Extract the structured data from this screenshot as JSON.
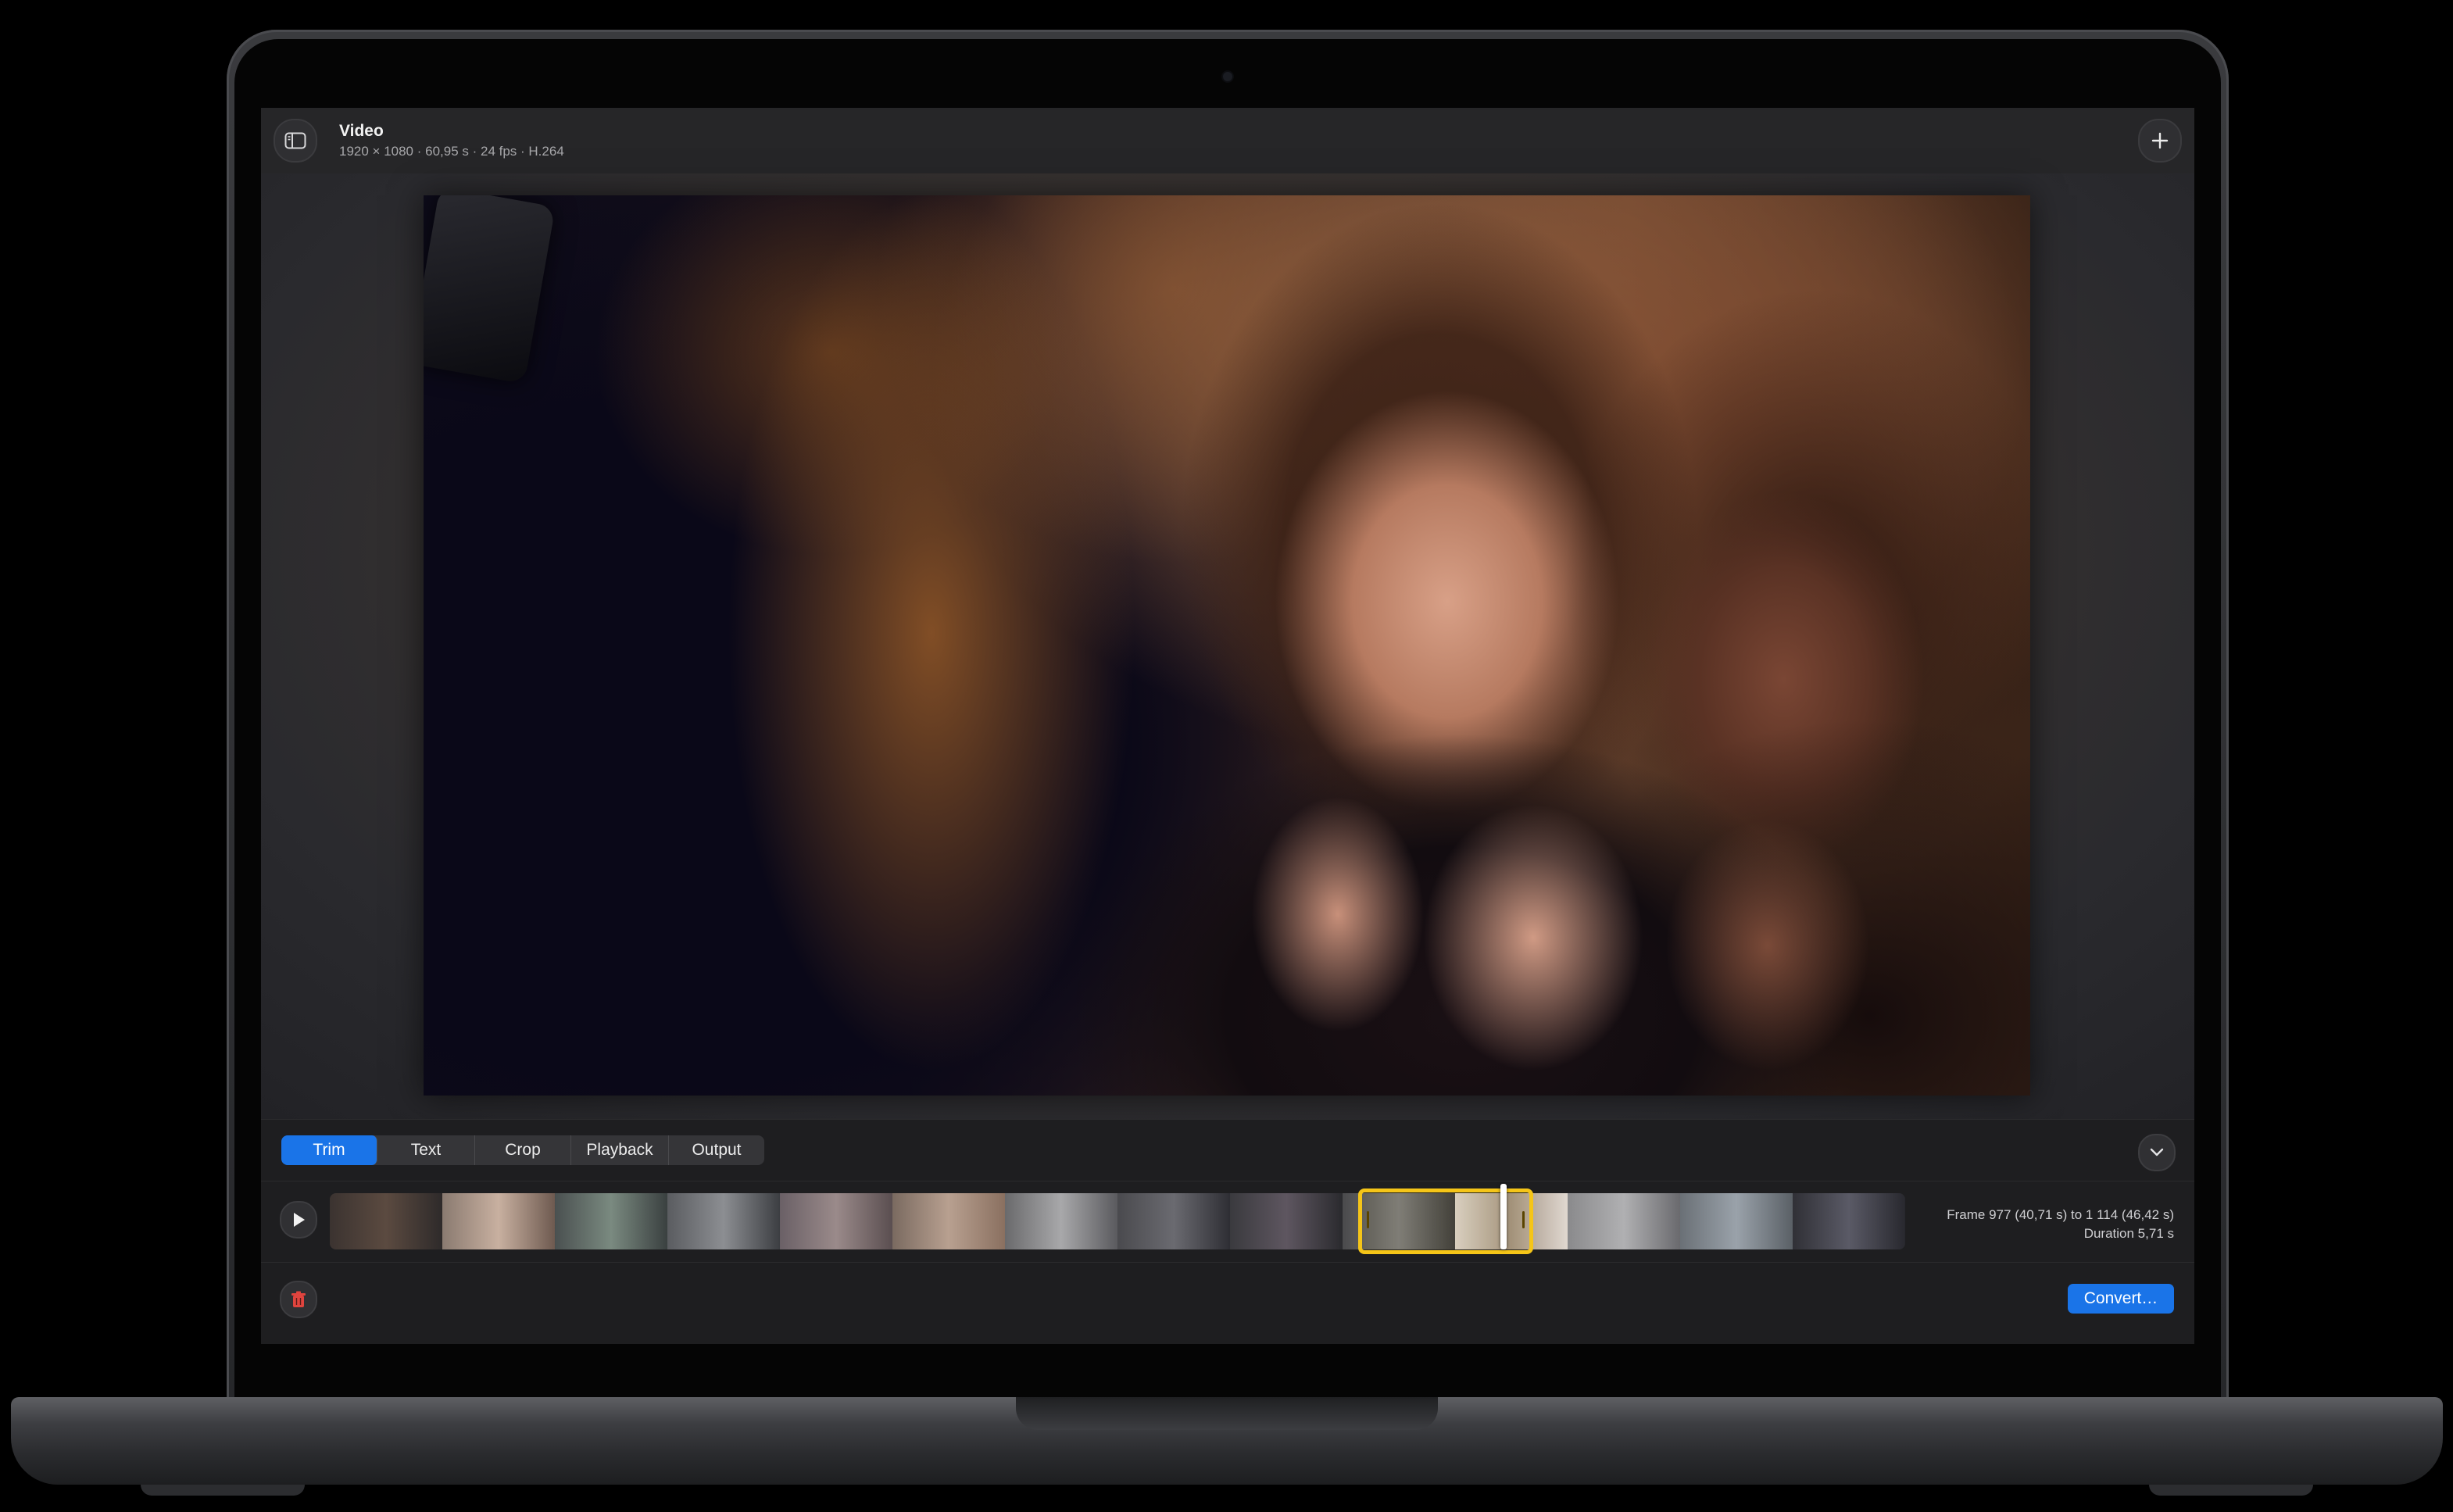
{
  "window": {
    "title": "Video",
    "subtitle": "1920 × 1080 · 60,95 s · 24 fps · H.264"
  },
  "icons": {
    "sidebar": "sidebar-toggle-icon",
    "add": "plus-icon",
    "collapse": "chevron-down-icon",
    "play": "play-icon",
    "delete": "trash-icon"
  },
  "tabs": [
    {
      "label": "Trim",
      "active": true
    },
    {
      "label": "Text",
      "active": false
    },
    {
      "label": "Crop",
      "active": false
    },
    {
      "label": "Playback",
      "active": false
    },
    {
      "label": "Output",
      "active": false
    }
  ],
  "trim": {
    "frame_range": "Frame 977 (40,71 s) to 1 114 (46,42 s)",
    "duration": "Duration 5,71 s"
  },
  "actions": {
    "convert": "Convert…"
  },
  "colors": {
    "accent": "#1a74e8",
    "selection": "#f5c518",
    "delete": "#e0443e"
  }
}
